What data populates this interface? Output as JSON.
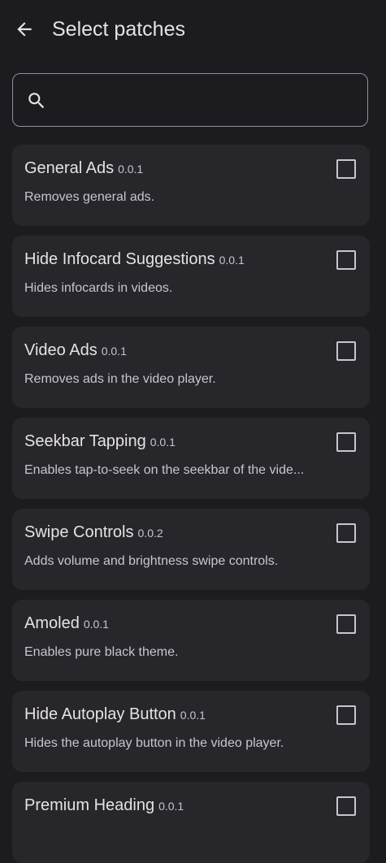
{
  "header": {
    "title": "Select patches",
    "back_icon": "arrow-back-icon"
  },
  "search": {
    "placeholder": "",
    "value": "",
    "icon": "search-icon"
  },
  "patches": [
    {
      "name": "General Ads",
      "version": "0.0.1",
      "description": "Removes general ads.",
      "checked": false
    },
    {
      "name": "Hide Infocard Suggestions",
      "version": "0.0.1",
      "description": "Hides infocards in videos.",
      "checked": false
    },
    {
      "name": "Video Ads",
      "version": "0.0.1",
      "description": "Removes ads in the video player.",
      "checked": false
    },
    {
      "name": "Seekbar Tapping",
      "version": "0.0.1",
      "description": "Enables tap-to-seek on the seekbar of the vide...",
      "checked": false
    },
    {
      "name": "Swipe Controls",
      "version": "0.0.2",
      "description": "Adds volume and brightness swipe controls.",
      "checked": false
    },
    {
      "name": "Amoled",
      "version": "0.0.1",
      "description": "Enables pure black theme.",
      "checked": false
    },
    {
      "name": "Hide Autoplay Button",
      "version": "0.0.1",
      "description": "Hides the autoplay button in the video player.",
      "checked": false
    },
    {
      "name": "Premium Heading",
      "version": "0.0.1",
      "description": "",
      "checked": false
    }
  ],
  "colors": {
    "background": "#1c1b1f",
    "card": "#27262b",
    "text_primary": "#e6e1e5",
    "text_secondary": "#cac4d0",
    "outline": "#938f99"
  }
}
